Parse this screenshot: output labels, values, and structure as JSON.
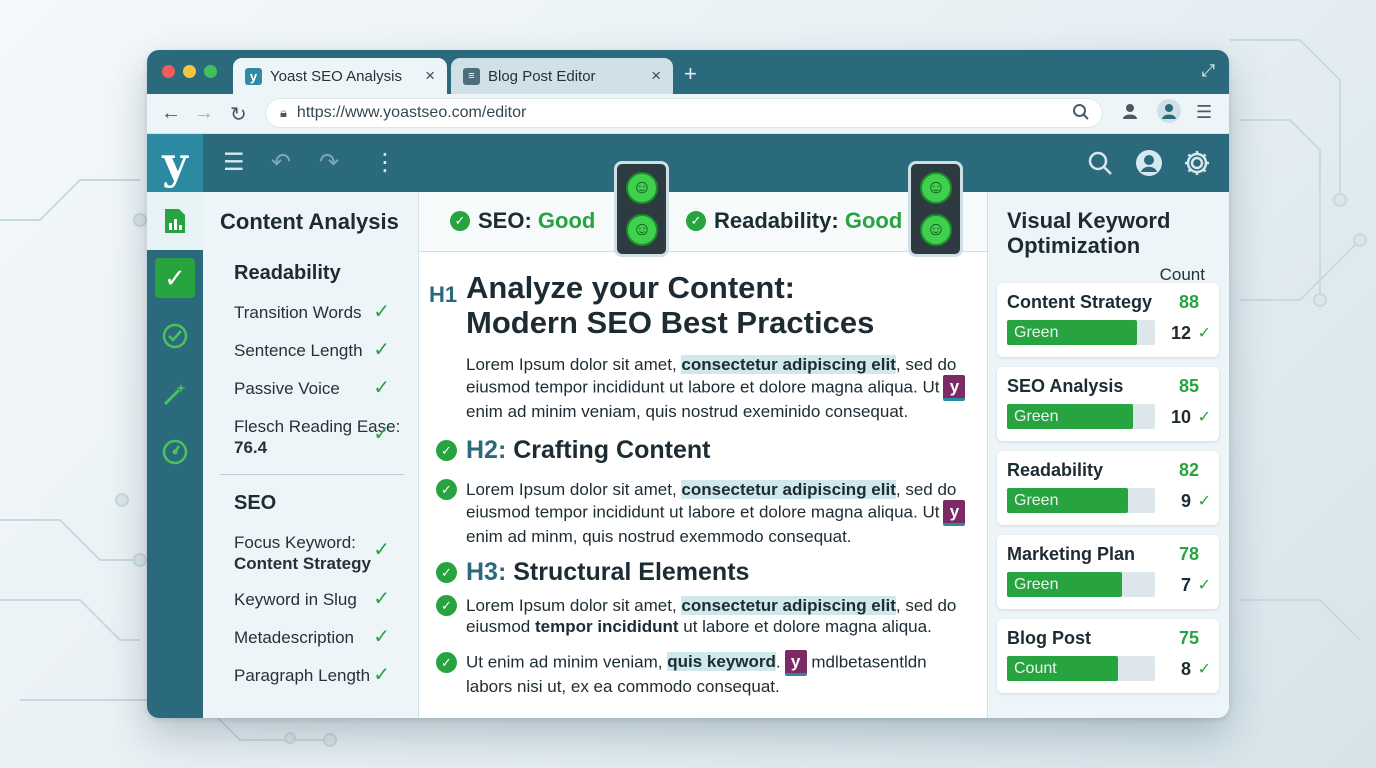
{
  "browser": {
    "tabs": [
      {
        "label": "Yoast SEO Analysis",
        "favicon": "yoast-y-icon",
        "close": "×"
      },
      {
        "label": "Blog Post Editor",
        "favicon": "document-icon",
        "close": "×"
      }
    ],
    "new_tab": "+",
    "url": "https://www.yoastseo.com/editor"
  },
  "toolbar": {
    "logo": "y"
  },
  "left_panel": {
    "title": "Content Analysis",
    "readability": {
      "heading": "Readability",
      "items": [
        {
          "label": "Transition Words"
        },
        {
          "label": "Sentence Length"
        },
        {
          "label": "Passive Voice"
        },
        {
          "label": "Flesch Reading Ease:",
          "value": "76.4"
        }
      ]
    },
    "seo": {
      "heading": "SEO",
      "items": [
        {
          "label": "Focus Keyword:",
          "value": "Content Strategy"
        },
        {
          "label": "Keyword in Slug"
        },
        {
          "label": "Metadescription"
        },
        {
          "label": "Paragraph Length"
        }
      ]
    }
  },
  "status": {
    "seo_label": "SEO:",
    "seo_value": "Good",
    "readability_label": "Readability:",
    "readability_value": "Good"
  },
  "content": {
    "h1_tag": "H1",
    "h1_line1": "Analyze your Content:",
    "h1_line2": "Modern SEO Best Practices",
    "p1": {
      "a": "Lorem Ipsum dolor sit amet, ",
      "hl": "consectetur adipiscing elit",
      "b": ", sed do eiusmod tempor incididunt ut labore et dolore magna aliqua. Ut",
      "c": "enim ad minim veniam, quis nostrud exeminido consequat."
    },
    "h2_tag": "H2:",
    "h2_text": "Crafting Content",
    "p2": {
      "a": "Lorem Ipsum dolor sit amet, ",
      "hl": "consectetur adipiscing elit",
      "b": ", sed do eiusmod tempor incididunt ut labore et dolore magna aliqua. Ut",
      "c": "enim ad minm, quis nostrud exemmodo consequat."
    },
    "h3_tag": "H3:",
    "h3_text": "Structural Elements",
    "p3": {
      "a": "Lorem Ipsum dolor sit amet, ",
      "hl": "consectetur adipiscing elit",
      "b": ", sed do eiusmod ",
      "bold": "tempor incididunt",
      "c": " ut labore et dolore magna aliqua."
    },
    "p4": {
      "a": "Ut enim ad minim veniam, ",
      "hl": "quis keyword",
      "b": ".",
      "c": " mdlbetasentldn",
      "d": "labors nisi ut, ex ea commodo consequat."
    },
    "badge_letter": "y"
  },
  "right_panel": {
    "title": "Visual Keyword Optimization",
    "count_header": "Count",
    "cards": [
      {
        "name": "Content Strategy",
        "score": 88,
        "bar_label": "Green",
        "count": "12"
      },
      {
        "name": "SEO Analysis",
        "score": 85,
        "bar_label": "Green",
        "count": "10"
      },
      {
        "name": "Readability",
        "score": 82,
        "bar_label": "Green",
        "count": "9"
      },
      {
        "name": "Marketing Plan",
        "score": 78,
        "bar_label": "Green",
        "count": "7"
      },
      {
        "name": "Blog Post",
        "score": 75,
        "bar_label": "Count",
        "count": "8"
      }
    ]
  },
  "colors": {
    "brand_teal": "#2b6a7c",
    "good_green": "#27a340",
    "yoast_purple": "#7b2a66"
  }
}
